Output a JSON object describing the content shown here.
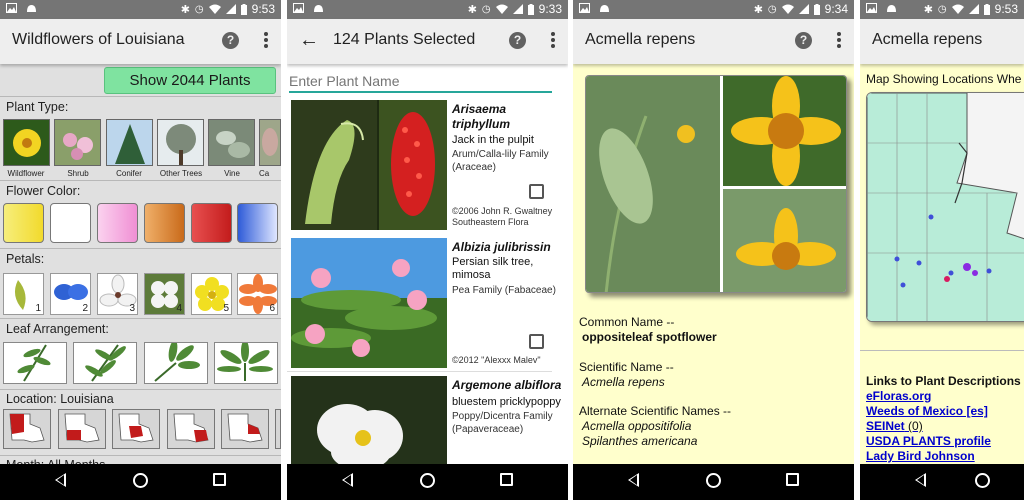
{
  "status": [
    {
      "time": "9:53"
    },
    {
      "time": "9:33"
    },
    {
      "time": "9:34"
    },
    {
      "time": "9:53"
    }
  ],
  "screen1": {
    "title": "Wildflowers of Louisiana",
    "show_button": "Show 2044 Plants",
    "plant_type_label": "Plant Type:",
    "plant_types": [
      "Wildflower",
      "Shrub",
      "Conifer",
      "Other Trees",
      "Vine",
      "Ca"
    ],
    "flower_color_label": "Flower Color:",
    "colors": [
      "#f7e34a",
      "#ffffff",
      "#f6a6dd",
      "#de8a34",
      "#d63030",
      "#3f6fe2"
    ],
    "petals_label": "Petals:",
    "petal_counts": [
      "1",
      "2",
      "3",
      "4",
      "5",
      "6"
    ],
    "leaf_label": "Leaf Arrangement:",
    "location_label": "Location: Louisiana",
    "month_label": "Month: All Months"
  },
  "screen2": {
    "title": "124 Plants Selected",
    "search_placeholder": "Enter Plant Name",
    "plants": [
      {
        "sci": "Arisaema triphyllum",
        "common": "Jack in the pulpit",
        "family": "Arum/Calla-lily Family (Araceae)",
        "credit": "©2006 John R. Gwaltney Southeastern Flora"
      },
      {
        "sci": "Albizia julibrissin",
        "common": "Persian silk tree, mimosa",
        "family": "Pea Family (Fabaceae)",
        "credit": "©2012 \"Alexxx Malev\""
      },
      {
        "sci": "Argemone albiflora",
        "common": "bluestem pricklypoppy",
        "family": "Poppy/Dicentra Family (Papaveraceae)",
        "credit": ""
      }
    ]
  },
  "screen3": {
    "title": "Acmella repens",
    "common_label": "Common Name --",
    "common_value": "oppositeleaf spotflower",
    "sci_label": "Scientific Name --",
    "sci_value": "Acmella repens",
    "alt_label": "Alternate Scientific Names --",
    "alt_values": [
      "Acmella oppositifolia",
      "Spilanthes americana"
    ]
  },
  "screen4": {
    "title": "Acmella repens",
    "map_label": "Map Showing Locations Whe",
    "links_heading": "Links to Plant Descriptions",
    "links": [
      {
        "label": "eFloras.org",
        "note": ""
      },
      {
        "label": "Weeds of Mexico [es]",
        "note": ""
      },
      {
        "label": "SEINet",
        "note": " (0)"
      },
      {
        "label": "USDA PLANTS profile",
        "note": ""
      },
      {
        "label": "Lady Bird Johnson",
        "note": ""
      }
    ]
  },
  "icons": [
    "image-icon",
    "android-icon",
    "bluetooth-icon",
    "alarm-icon",
    "wifi-icon",
    "signal-icon",
    "battery-icon",
    "help-icon",
    "more-vert-icon",
    "arrow-back-icon",
    "nav-back-icon",
    "nav-home-icon",
    "nav-recents-icon"
  ]
}
